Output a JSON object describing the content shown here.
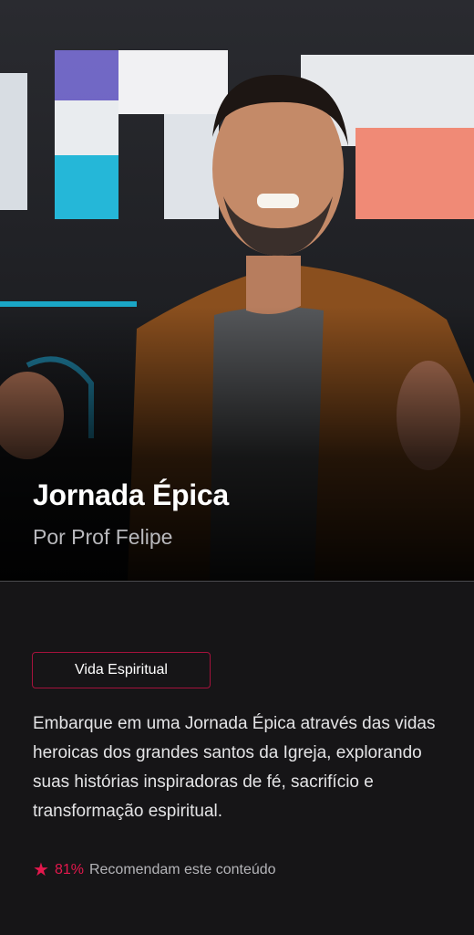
{
  "course": {
    "title": "Jornada Épica",
    "author": "Por Prof Felipe",
    "category": "Vida Espiritual",
    "description": "Embarque em uma Jornada Épica através das vidas heroicas dos grandes santos da Igreja, explorando suas histórias inspiradoras de fé, sacrifício e transformação espiritual.",
    "rating_percent": "81%",
    "rating_text": "Recomendam este conteúdo"
  },
  "icons": {
    "rating": "star-icon"
  },
  "colors": {
    "accent": "#e3184d",
    "tag_border": "#a5123c",
    "background": "#161517"
  }
}
